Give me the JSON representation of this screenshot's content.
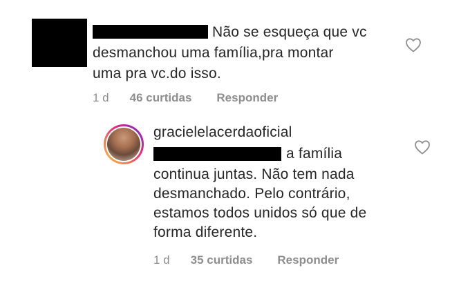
{
  "comment_1": {
    "text_line_1": "Não se esqueça que vc",
    "text_line_2": "desmanchou uma família,pra montar",
    "text_line_3": "uma pra vc.do isso.",
    "time": "1 d",
    "likes": "46 curtidas",
    "reply_label": "Responder"
  },
  "comment_2": {
    "username": "gracielelacerdaoficial",
    "text_line_1": "a família",
    "text_line_2": "continua juntas. Não tem nada",
    "text_line_3": "desmanchado. Pelo contrário,",
    "text_line_4": "estamos todos unidos só que de",
    "text_line_5": "forma diferente.",
    "time": "1 d",
    "likes": "35 curtidas",
    "reply_label": "Responder"
  },
  "icons": {
    "like": "heart-outline-icon"
  }
}
